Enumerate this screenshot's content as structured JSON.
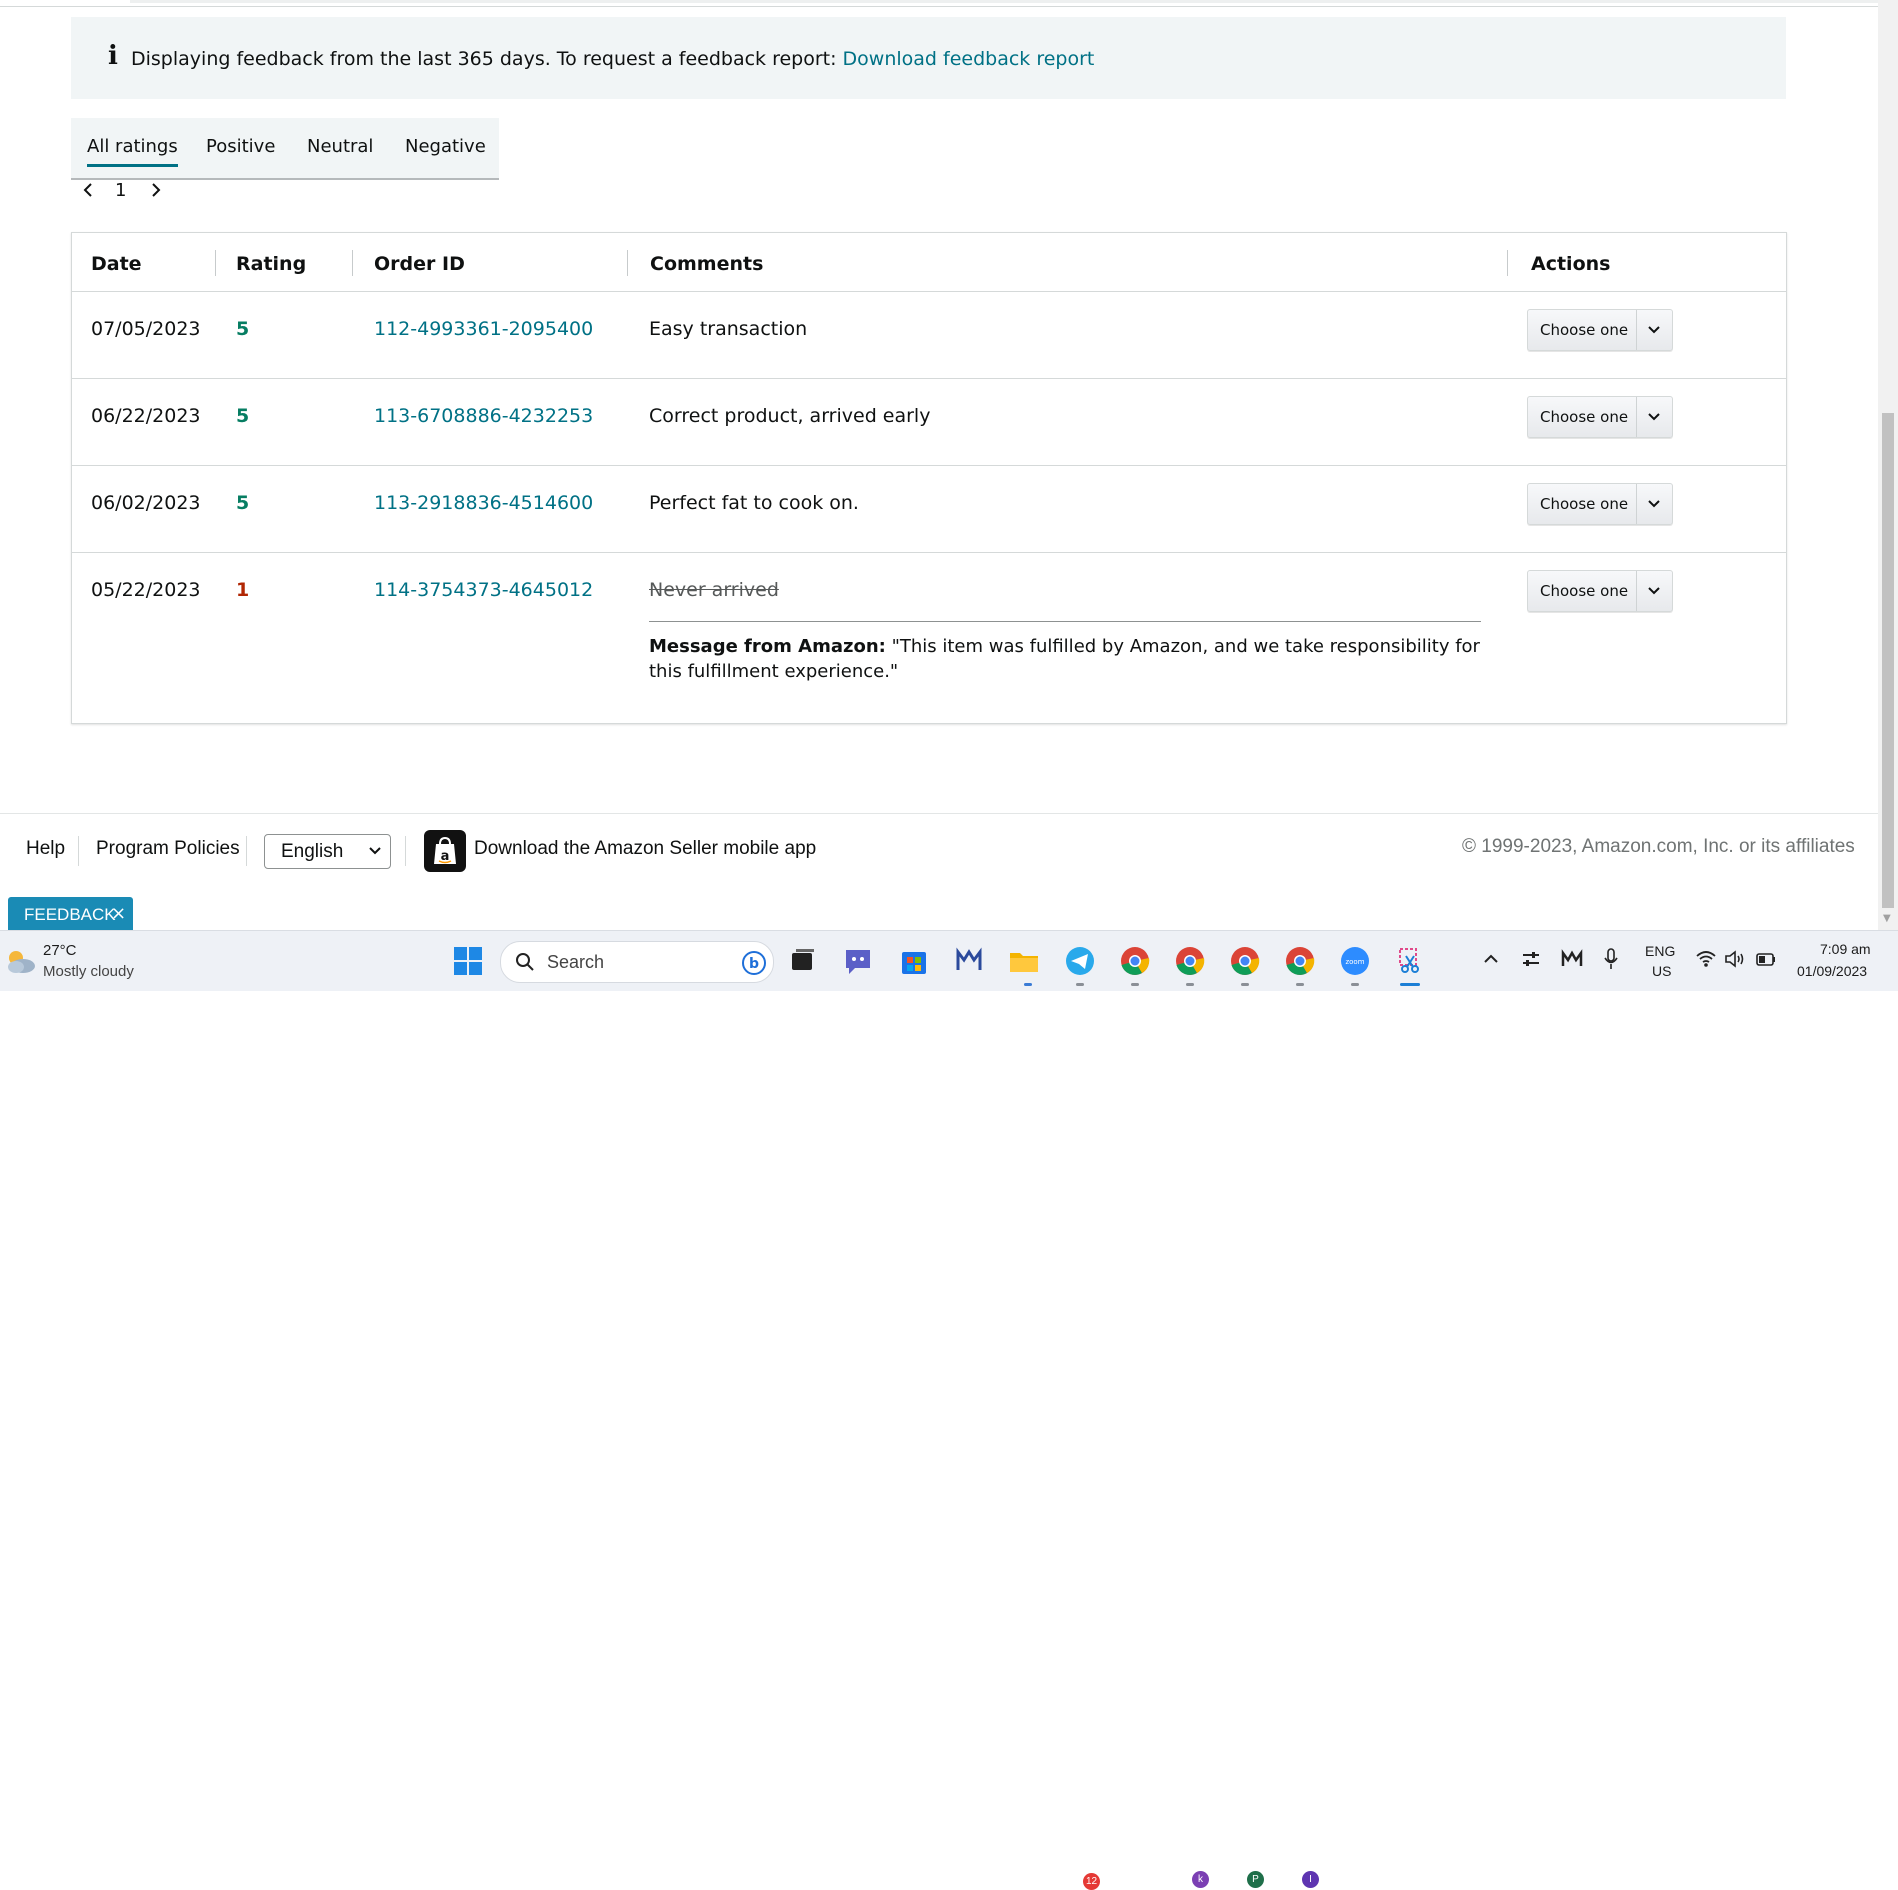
{
  "banner": {
    "message": "Displaying feedback from the last 365 days. To request a feedback report:",
    "link": "Download feedback report"
  },
  "tabs": [
    {
      "label": "All ratings",
      "active": true
    },
    {
      "label": "Positive",
      "active": false
    },
    {
      "label": "Neutral",
      "active": false
    },
    {
      "label": "Negative",
      "active": false
    }
  ],
  "pager": {
    "current_page": "1"
  },
  "table": {
    "headers": {
      "date": "Date",
      "rating": "Rating",
      "order_id": "Order ID",
      "comments": "Comments",
      "actions": "Actions"
    },
    "rows": [
      {
        "date": "07/05/2023",
        "rating": "5",
        "order_id": "112-4993361-2095400",
        "comment": "Easy transaction",
        "action": "Choose one"
      },
      {
        "date": "06/22/2023",
        "rating": "5",
        "order_id": "113-6708886-4232253",
        "comment": "Correct product, arrived early",
        "action": "Choose one"
      },
      {
        "date": "06/02/2023",
        "rating": "5",
        "order_id": "113-2918836-4514600",
        "comment": "Perfect fat to cook on.",
        "action": "Choose one"
      },
      {
        "date": "05/22/2023",
        "rating": "1",
        "order_id": "114-3754373-4645012",
        "comment": "Never arrived",
        "action": "Choose one",
        "amazon_message_label": "Message from Amazon:",
        "amazon_message": "\"This item was fulfilled by Amazon, and we take responsibility for this fulfillment experience.\""
      }
    ]
  },
  "colors": {
    "positive": "#067d62",
    "negative": "#b12704",
    "link": "#007185",
    "feedback_tab": "#1a8bb5"
  },
  "footer": {
    "help": "Help",
    "policies": "Program Policies",
    "language": "English",
    "app_link": "Download the Amazon Seller mobile app",
    "copyright": "© 1999-2023, Amazon.com, Inc. or its affiliates"
  },
  "feedback_tab": {
    "label": "FEEDBACK",
    "close": "×"
  },
  "taskbar": {
    "weather_temp": "27°C",
    "weather_desc": "Mostly cloudy",
    "search_placeholder": "Search",
    "telegram_badge": "12",
    "chrome_badges": [
      "k",
      "P",
      "I"
    ],
    "lang_top": "ENG",
    "lang_bottom": "US",
    "time": "7:09 am",
    "date": "01/09/2023"
  }
}
